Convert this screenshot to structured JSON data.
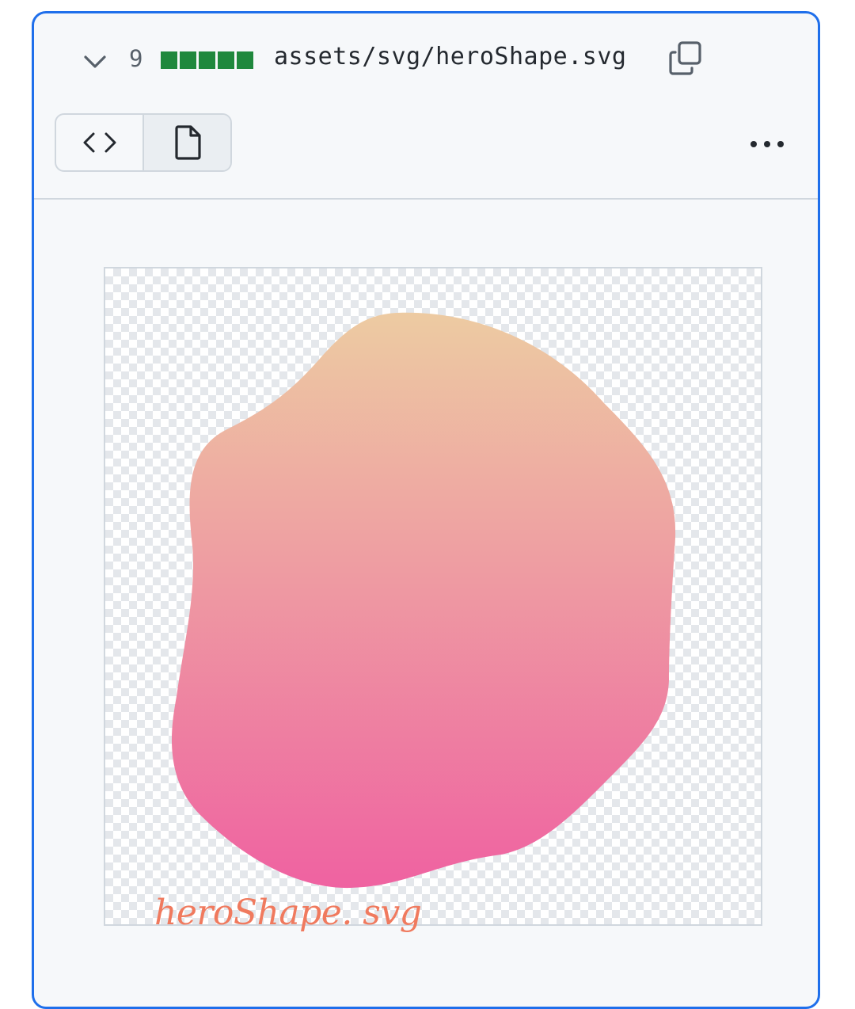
{
  "file": {
    "changes_count": "9",
    "path": "assets/svg/heroShape.svg",
    "diffstat_color": "#1f883d",
    "diffstat_blocks": 5
  },
  "icons": {
    "collapse": "chevron-down-icon",
    "copy": "copy-icon",
    "source_view": "code-icon",
    "rich_view": "file-icon",
    "more": "kebab-horizontal-icon"
  },
  "preview": {
    "gradient_top": "#edcba2",
    "gradient_bottom": "#ef62a1",
    "caption": "heroShape. svg",
    "caption_color": "#f07a5e"
  },
  "colors": {
    "accent_border": "#1f6feb",
    "card_bg": "#f6f8fa"
  }
}
